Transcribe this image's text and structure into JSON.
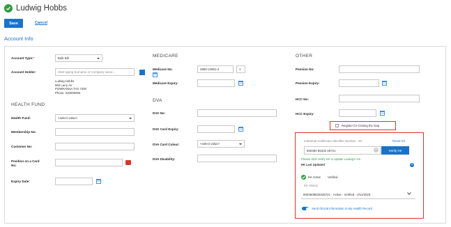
{
  "header": {
    "patient_name": "Ludwig Hobbs",
    "save_label": "Save",
    "cancel_label": "Cancel"
  },
  "section_title": "Account Info",
  "account": {
    "account_type_label": "Account Type:",
    "required_mark": "*",
    "account_type_value": "Bulk Bill",
    "account_holder_label": "Account Holder:",
    "account_holder_placeholder": "Start typing Surname or Company name...",
    "address_lines": [
      "Ludwig Hobbs",
      "950 Larry AV",
      "POWRANNA TAS 7300",
      "Phone: 040000000"
    ]
  },
  "health_fund": {
    "header": "HEALTH FUND",
    "health_fund_label": "Health Fund:",
    "health_fund_value": "<select value>",
    "membership_label": "Membership No:",
    "customer_label": "Customer No:",
    "position_label_1": "Position on a Card",
    "position_label_2": "No:",
    "expiry_label": "Expiry Date:"
  },
  "medicare": {
    "header": "MEDICARE",
    "medicare_no_label": "Medicare No:",
    "medicare_no_value": "2950-24901-2",
    "irn_value": "1",
    "medicare_expiry_label": "Medicare Expiry:"
  },
  "dva": {
    "header": "DVA",
    "dva_no_label": "DVA No:",
    "card_expiry_label": "DVA Card Expiry:",
    "card_colour_label": "DVA Card Colour:",
    "card_colour_value": "<select value>",
    "disability_label": "DVA Disability:"
  },
  "other": {
    "header": "OTHER",
    "pension_no_label": "Pension No:",
    "pension_expiry_label": "Pension Expiry:",
    "hcc_no_label": "HCC No:",
    "hcc_expiry_label": "HCC Expiry:",
    "closing_gap_label": "Register for Closing the Gap"
  },
  "ihi": {
    "field_label": "Individual Healthcare Identifier Number - IHI",
    "reset_label": "Reset IHI",
    "ihi_value": "800360 86333 45721",
    "verify_label": "Verify IHI",
    "hint": "Please click Verify IHI to update Ludwig's IHI",
    "last_updated_label": "IHI Last Updated",
    "status_active": "IHI Active",
    "status_verified": "Verified",
    "history_label": "IHI History",
    "history_value": "8003608633345721 - Active - Verified - 2/11/2023",
    "send_label": "Send clinical information to My Health Record"
  },
  "colors": {
    "accent": "#1a73c8",
    "highlight": "#d9342b",
    "success": "#2e9e3e"
  }
}
